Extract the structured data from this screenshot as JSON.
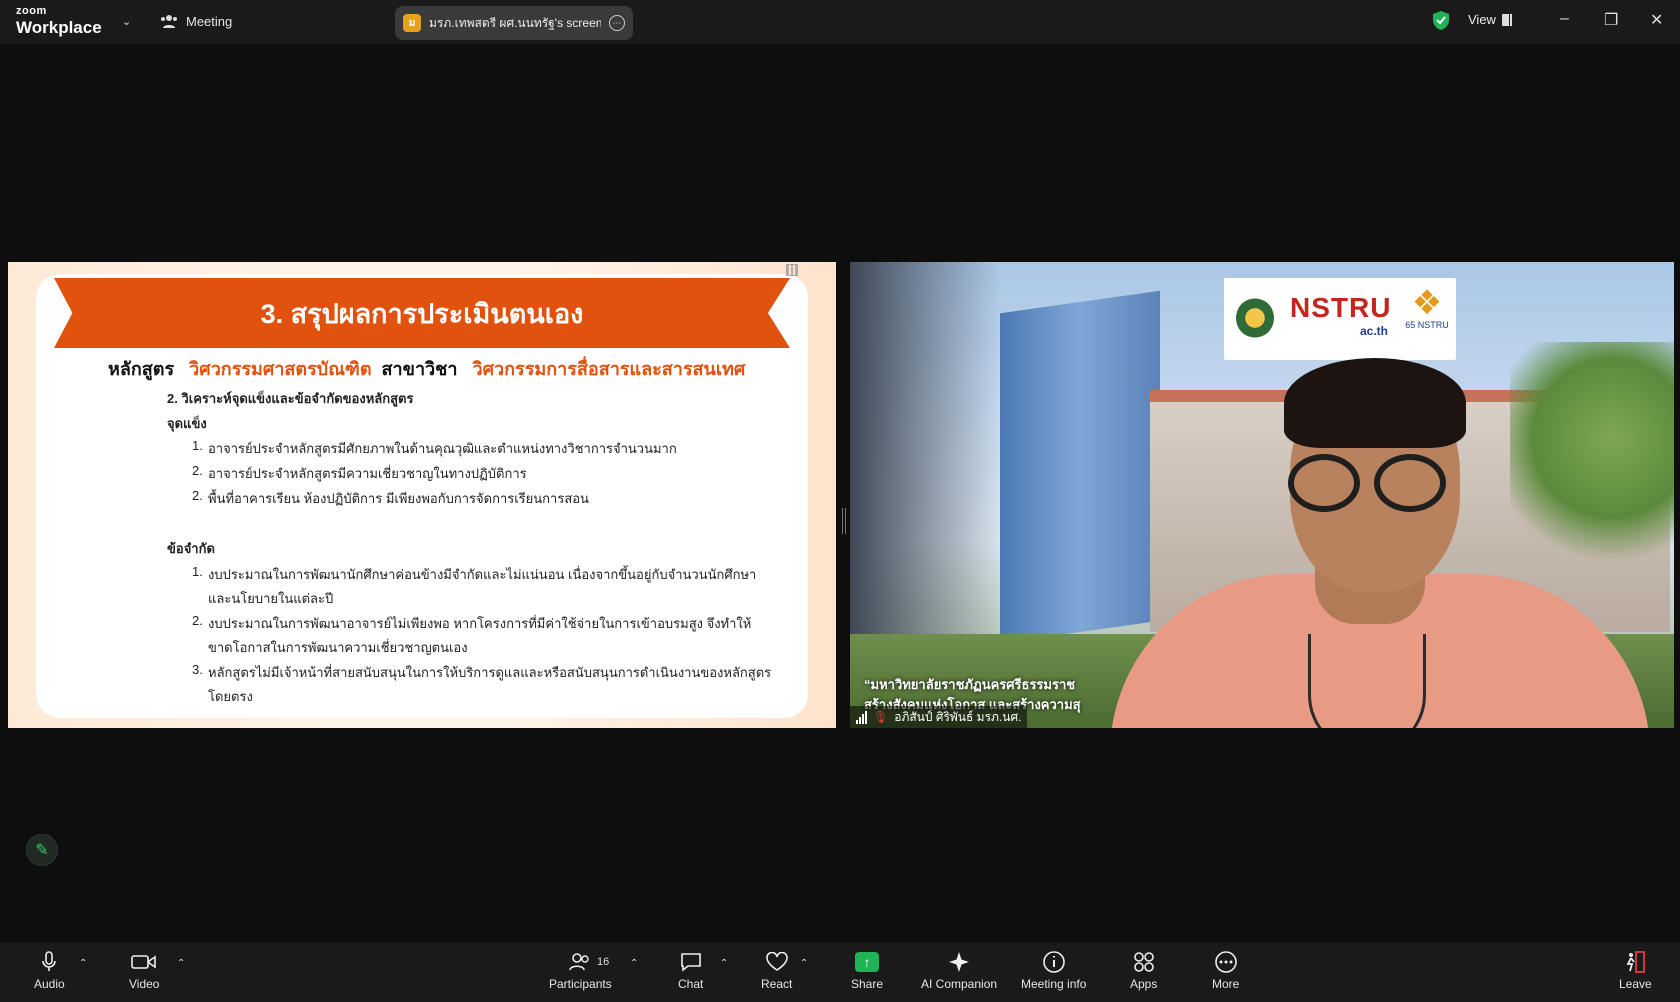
{
  "app": {
    "brand_small": "zoom",
    "brand_large": "Workplace"
  },
  "titlebar": {
    "meeting_label": "Meeting",
    "screen_share_label": "มรภ.เทพสตรี ผศ.นนทรัฐ's screen",
    "screen_share_avatar": "ม",
    "view_label": "View",
    "shield_color": "#1fb557"
  },
  "slide": {
    "title": "3. สรุปผลการประเมินตนเอง",
    "course_prefix": "หลักสูตร",
    "course_name": "วิศวกรรมศาสตรบัณฑิต",
    "major_prefix": "สาขาวิชา",
    "major_name": "วิศวกรรมการสื่อสารและสารสนเทศ",
    "section": "2. วิเคราะห์จุดแข็งและข้อจำกัดของหลักสูตร",
    "strengths_heading": "จุดแข็ง",
    "strengths": [
      {
        "num": "1.",
        "text": "อาจารย์ประจำหลักสูตรมีศักยภาพในด้านคุณวุฒิและตำแหน่งทางวิชาการจำนวนมาก"
      },
      {
        "num": "2.",
        "text": "อาจารย์ประจำหลักสูตรมีความเชี่ยวชาญในทางปฏิบัติการ"
      },
      {
        "num": "2.",
        "text": "พื้นที่อาคารเรียน ห้องปฏิบัติการ มีเพียงพอกับการจัดการเรียนการสอน"
      }
    ],
    "limits_heading": "ข้อจำกัด",
    "limits": [
      {
        "num": "1.",
        "line1": "งบประมาณในการพัฒนานักศึกษาค่อนข้างมีจำกัดและไม่แน่นอน เนื่องจากขึ้นอยู่กับจำนวนนักศึกษา",
        "line2": "และนโยบายในแต่ละปี"
      },
      {
        "num": "2.",
        "line1": "งบประมาณในการพัฒนาอาจารย์ไม่เพียงพอ หากโครงการที่มีค่าใช้จ่ายในการเข้าอบรมสูง จึงทำให้",
        "line2": "ขาดโอกาสในการพัฒนาความเชี่ยวชาญตนเอง"
      },
      {
        "num": "3.",
        "line1": "หลักสูตรไม่มีเจ้าหน้าที่สายสนับสนุนในการให้บริการดูแลและหรือสนับสนุนการดำเนินงานของหลักสูตร",
        "line2": "โดยตรง"
      }
    ],
    "accent_color": "#e2520f"
  },
  "video": {
    "logo_word": "NSTRU",
    "logo_domain": "ac.th",
    "logo_anniv": "65 NSTRU",
    "caption_line1": "“มหาวิทยาลัยราชภัฏนครศรีธรรมราช",
    "caption_line2": "สร้างสังคมแห่งโอกาส และสร้างความสุ",
    "participant_name": "อภิสันป์ ศิริพันธ์ มรภ.นศ."
  },
  "toolbar": {
    "audio": "Audio",
    "video": "Video",
    "participants": "Participants",
    "participants_count": "16",
    "chat": "Chat",
    "react": "React",
    "share": "Share",
    "ai_companion": "AI Companion",
    "meeting_info": "Meeting info",
    "apps": "Apps",
    "more": "More",
    "leave": "Leave"
  }
}
